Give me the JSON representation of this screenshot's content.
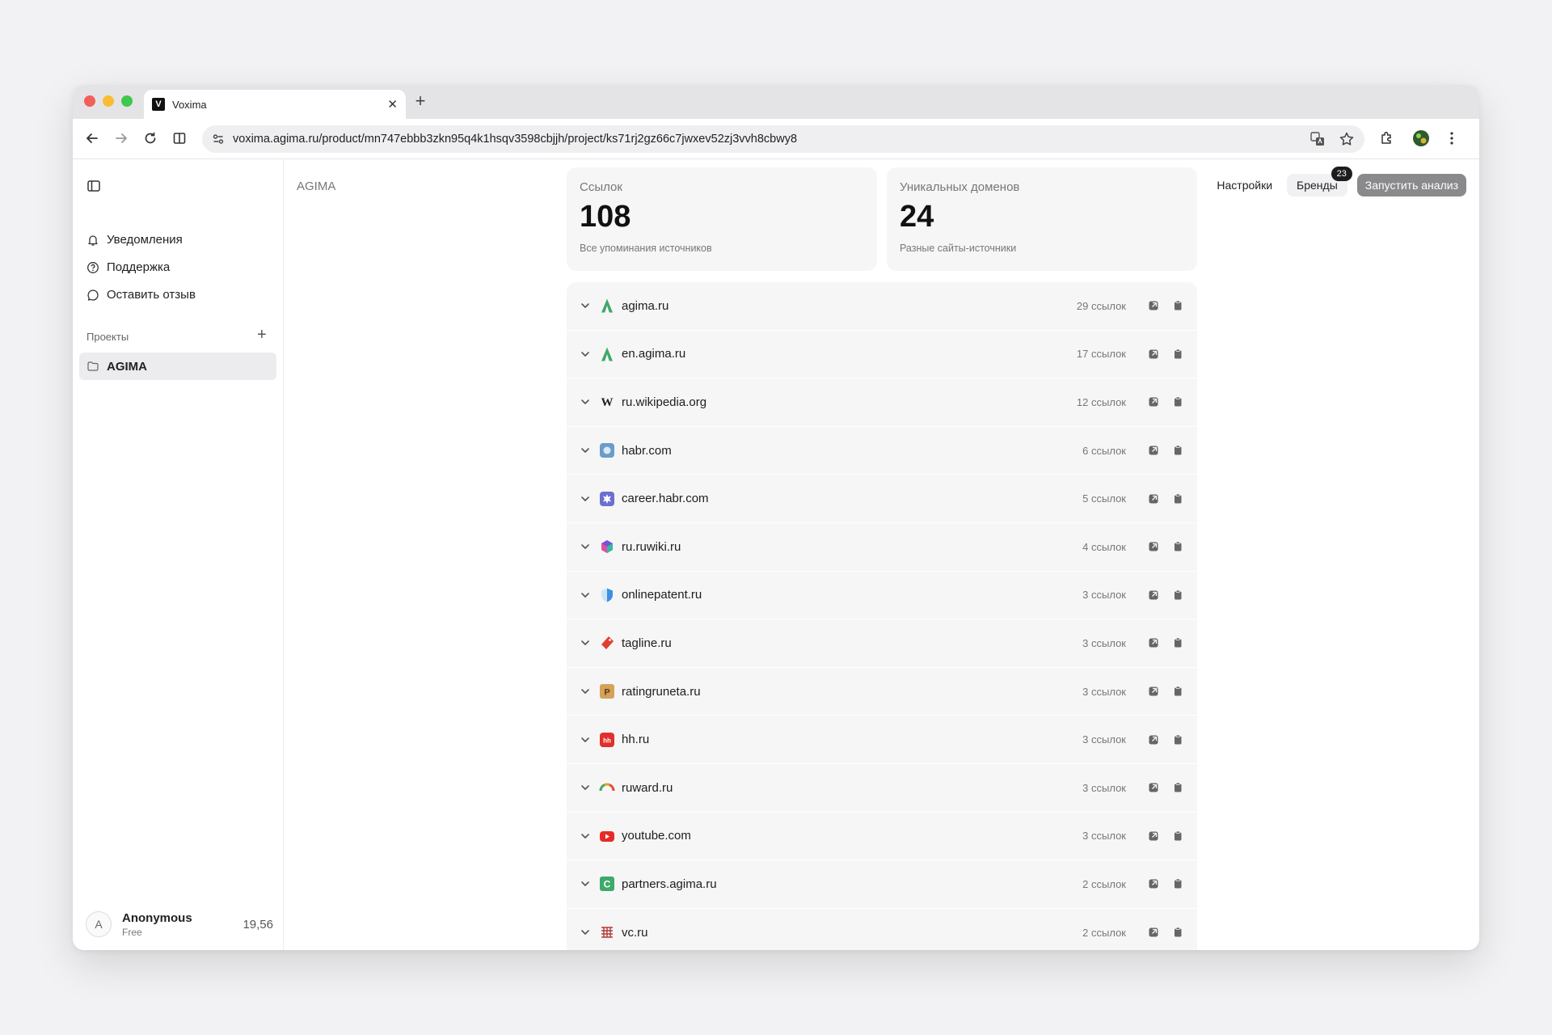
{
  "browser": {
    "tab_title": "Voxima",
    "tab_favicon": "V",
    "url": "voxima.agima.ru/product/mn747ebbb3zkn95q4k1hsqv3598cbjjh/project/ks71rj2gz66c7jwxev52zj3vvh8cbwy8"
  },
  "sidebar": {
    "items": [
      {
        "label": "Уведомления",
        "icon": "bell-icon"
      },
      {
        "label": "Поддержка",
        "icon": "help-circle-icon"
      },
      {
        "label": "Оставить отзыв",
        "icon": "message-circle-icon"
      }
    ],
    "projects_label": "Проекты",
    "projects": [
      {
        "label": "AGIMA",
        "icon": "folder-icon"
      }
    ],
    "user": {
      "avatar_letter": "A",
      "name": "Anonymous",
      "plan": "Free",
      "balance": "19,56"
    }
  },
  "header": {
    "breadcrumb": "AGIMA",
    "settings_label": "Настройки",
    "brands_label": "Бренды",
    "brands_badge": "23",
    "run_label": "Запустить анализ"
  },
  "stats": [
    {
      "label": "Ссылок",
      "value": "108",
      "sub": "Все упоминания источников"
    },
    {
      "label": "Уникальных доменов",
      "value": "24",
      "sub": "Разные сайты-источники"
    }
  ],
  "domains": [
    {
      "name": "agima.ru",
      "count": "29 ссылок",
      "favicon": "agima",
      "color": "#3fa96a"
    },
    {
      "name": "en.agima.ru",
      "count": "17 ссылок",
      "favicon": "agima",
      "color": "#3fa96a"
    },
    {
      "name": "ru.wikipedia.org",
      "count": "12 ссылок",
      "favicon": "wikipedia",
      "color": "#222222"
    },
    {
      "name": "habr.com",
      "count": "6 ссылок",
      "favicon": "habr",
      "color": "#6a9cc9"
    },
    {
      "name": "career.habr.com",
      "count": "5 ссылок",
      "favicon": "career",
      "color": "#6b6fd0"
    },
    {
      "name": "ru.ruwiki.ru",
      "count": "4 ссылок",
      "favicon": "ruwiki",
      "color": "#7b4fd8"
    },
    {
      "name": "onlinepatent.ru",
      "count": "3 ссылок",
      "favicon": "shield",
      "color": "#3f8fe0"
    },
    {
      "name": "tagline.ru",
      "count": "3 ссылок",
      "favicon": "tag",
      "color": "#e0402f"
    },
    {
      "name": "ratingruneta.ru",
      "count": "3 ссылок",
      "favicon": "rating",
      "color": "#d4a35a"
    },
    {
      "name": "hh.ru",
      "count": "3 ссылок",
      "favicon": "hh",
      "color": "#e0302c"
    },
    {
      "name": "ruward.ru",
      "count": "3 ссылок",
      "favicon": "ruward",
      "color": "#e5a12a"
    },
    {
      "name": "youtube.com",
      "count": "3 ссылок",
      "favicon": "youtube",
      "color": "#e52d27"
    },
    {
      "name": "partners.agima.ru",
      "count": "2 ссылок",
      "favicon": "partners",
      "color": "#3fa96a"
    },
    {
      "name": "vc.ru",
      "count": "2 ссылок",
      "favicon": "vc",
      "color": "#b23a3a"
    }
  ]
}
